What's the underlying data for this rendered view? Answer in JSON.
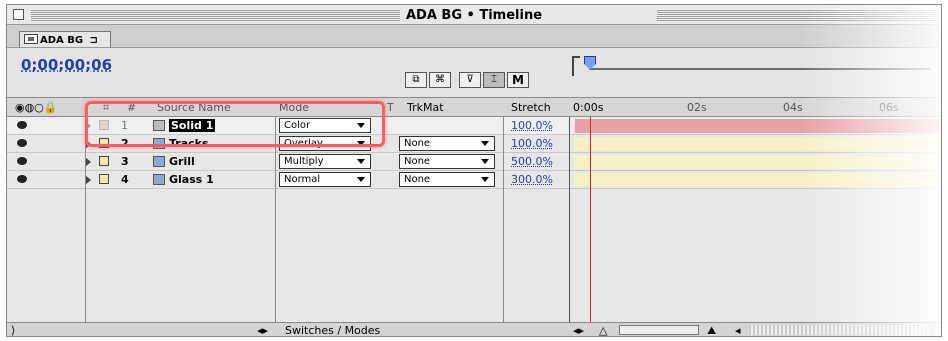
{
  "window": {
    "title": "ADA BG • Timeline"
  },
  "tab": {
    "label": "ADA BG"
  },
  "toolbar": {
    "timecode": "0;00;00;06"
  },
  "header": {
    "number": "#",
    "source_name": "Source Name",
    "mode": "Mode",
    "t_col": "T",
    "trkmat": "TrkMat",
    "stretch": "Stretch",
    "ruler": [
      "0:00s",
      "02s",
      "04s",
      "06s"
    ]
  },
  "layers": [
    {
      "number": "1",
      "name": "Solid 1",
      "mode": "Color",
      "trkmat": "",
      "stretch": "100.0%",
      "color": "#cfcfcf"
    },
    {
      "number": "2",
      "name": "Tracks",
      "mode": "Overlay",
      "trkmat": "None",
      "stretch": "100.0%",
      "color": "#f4e7a8"
    },
    {
      "number": "3",
      "name": "Grill",
      "mode": "Multiply",
      "trkmat": "None",
      "stretch": "500.0%",
      "color": "#f4e7a8"
    },
    {
      "number": "4",
      "name": "Glass 1",
      "mode": "Normal",
      "trkmat": "None",
      "stretch": "300.0%",
      "color": "#f4e7a8"
    }
  ],
  "bottombar": {
    "switches_modes": "Switches / Modes"
  },
  "colors": {
    "highlight": "#ff5b63",
    "time_indicator": "#e32020",
    "timecode": "#1f3fb0",
    "solid_bar": "#e8a0a4",
    "yellow_bar": "#f7f0c6"
  }
}
